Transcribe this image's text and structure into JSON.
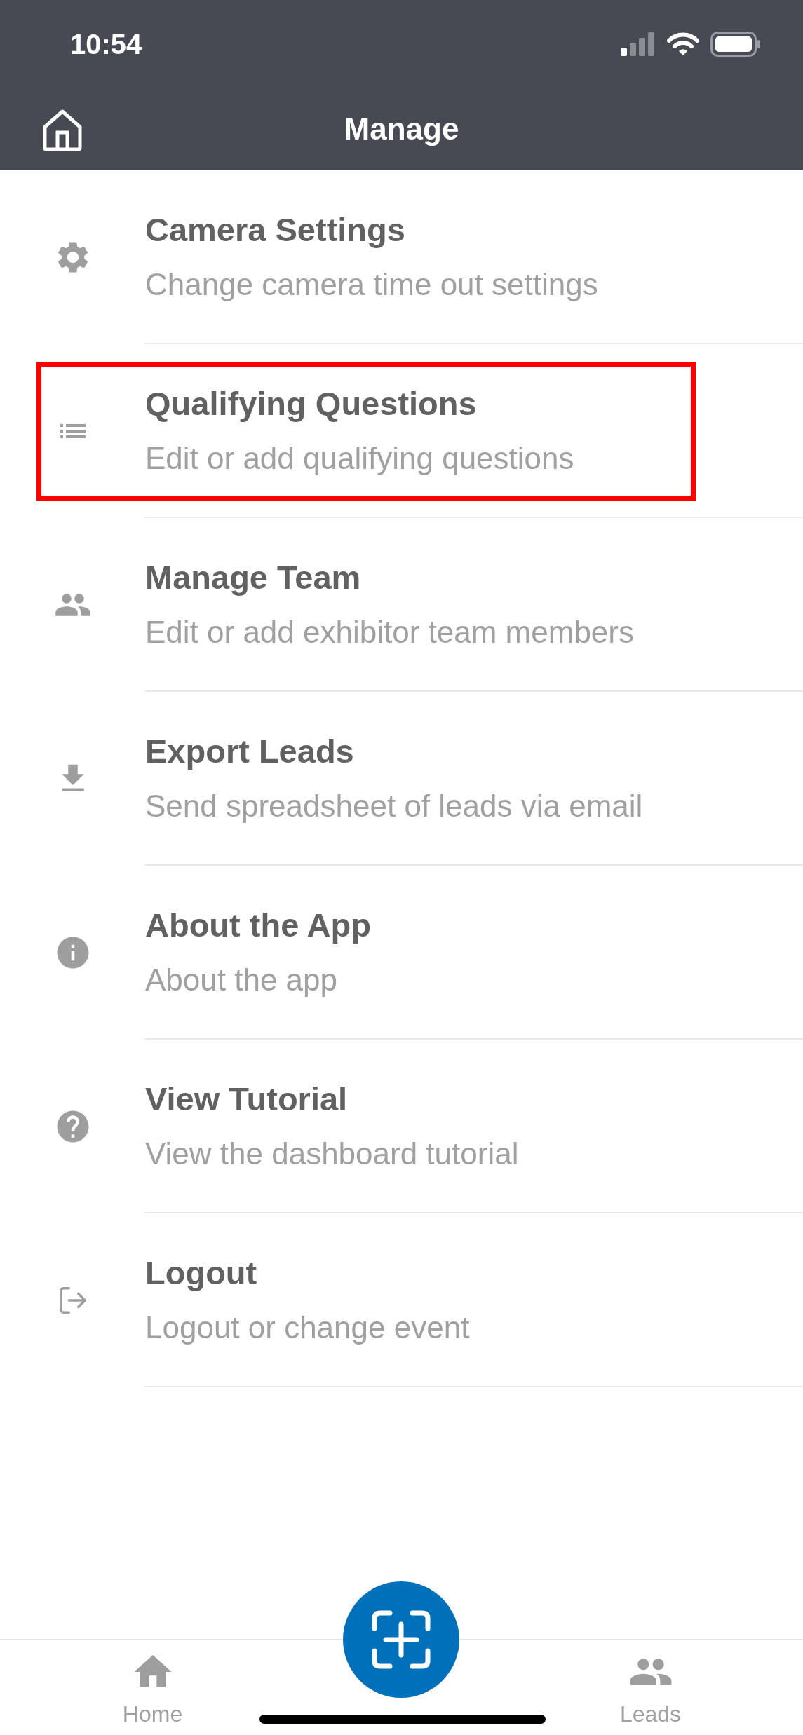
{
  "status_bar": {
    "time": "10:54"
  },
  "header": {
    "title": "Manage"
  },
  "items": [
    {
      "title": "Camera Settings",
      "subtitle": "Change camera time out settings",
      "highlighted": false
    },
    {
      "title": "Qualifying Questions",
      "subtitle": "Edit or add qualifying questions",
      "highlighted": true
    },
    {
      "title": "Manage Team",
      "subtitle": "Edit or add exhibitor team members",
      "highlighted": false
    },
    {
      "title": "Export Leads",
      "subtitle": "Send spreadsheet of leads via email",
      "highlighted": false
    },
    {
      "title": "About the App",
      "subtitle": "About the app",
      "highlighted": false
    },
    {
      "title": "View Tutorial",
      "subtitle": "View the dashboard tutorial",
      "highlighted": false
    },
    {
      "title": "Logout",
      "subtitle": "Logout or change event",
      "highlighted": false
    }
  ],
  "tab_bar": [
    {
      "label": "Home"
    },
    {
      "kind": "scan"
    },
    {
      "label": "Leads"
    }
  ]
}
